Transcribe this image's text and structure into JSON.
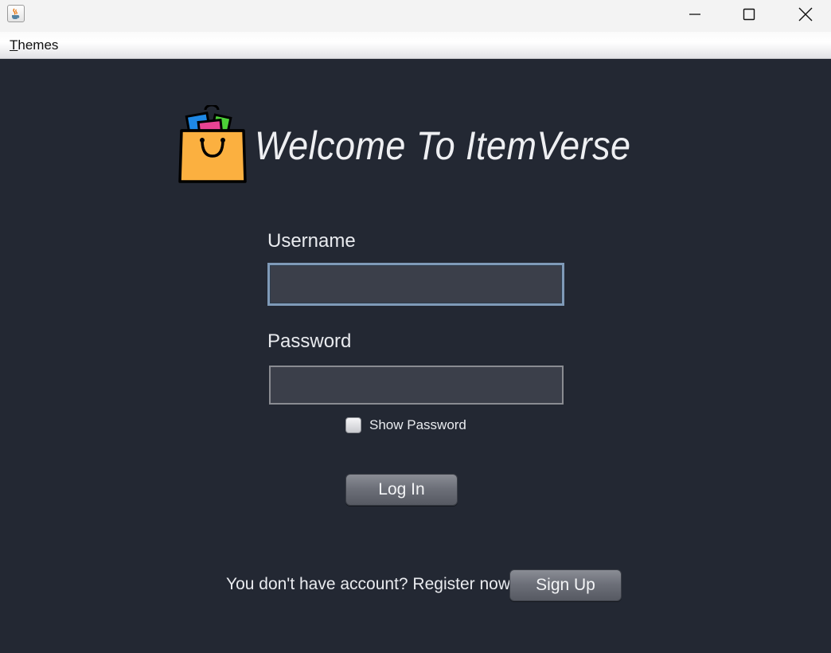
{
  "window": {
    "app_icon": "java-coffee-cup-icon",
    "controls": {
      "minimize_icon": "minimize-icon",
      "maximize_icon": "maximize-icon",
      "close_icon": "close-icon"
    }
  },
  "menubar": {
    "themes_mnemonic": "T",
    "themes_rest": "hemes"
  },
  "header": {
    "logo_icon": "shopping-bag-icon",
    "title": "Welcome To ItemVerse"
  },
  "form": {
    "username_label": "Username",
    "username_value": "",
    "password_label": "Password",
    "password_value": "",
    "show_password_label": "Show Password",
    "show_password_checked": false,
    "login_button": "Log In"
  },
  "footer": {
    "register_text": "You don't have account? Register now",
    "signup_button": "Sign Up"
  },
  "colors": {
    "background": "#232833",
    "field_background": "#3b3f4a",
    "focus_border": "#7f9ab8",
    "text": "#e9ebef",
    "bag_yellow": "#fbb040"
  }
}
